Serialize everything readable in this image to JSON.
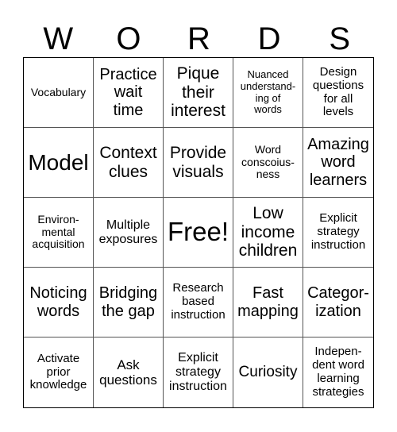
{
  "title_letters": [
    "W",
    "O",
    "R",
    "D",
    "S"
  ],
  "cells": [
    {
      "text": "Vocabulary",
      "size": 14
    },
    {
      "text": "Practice\nwait\ntime",
      "size": 20
    },
    {
      "text": "Pique\ntheir\ninterest",
      "size": 21
    },
    {
      "text": "Nuanced\nunderstand-\ning of\nwords",
      "size": 13
    },
    {
      "text": "Design\nquestions\nfor all\nlevels",
      "size": 15
    },
    {
      "text": "Model",
      "size": 28
    },
    {
      "text": "Context\nclues",
      "size": 21
    },
    {
      "text": "Provide\nvisuals",
      "size": 21
    },
    {
      "text": "Word\nconscoius-\nness",
      "size": 14
    },
    {
      "text": "Amazing\nword\nlearners",
      "size": 20
    },
    {
      "text": "Environ-\nmental\nacquisition",
      "size": 14
    },
    {
      "text": "Multiple\nexposures",
      "size": 16
    },
    {
      "text": "Free!",
      "size": 33
    },
    {
      "text": "Low\nincome\nchildren",
      "size": 21
    },
    {
      "text": "Explicit\nstrategy\ninstruction",
      "size": 15
    },
    {
      "text": "Noticing\nwords",
      "size": 20
    },
    {
      "text": "Bridging\nthe gap",
      "size": 20
    },
    {
      "text": "Research\nbased\ninstruction",
      "size": 15
    },
    {
      "text": "Fast\nmapping",
      "size": 20
    },
    {
      "text": "Categor-\nization",
      "size": 20
    },
    {
      "text": "Activate\nprior\nknowledge",
      "size": 15
    },
    {
      "text": "Ask\nquestions",
      "size": 17
    },
    {
      "text": "Explicit\nstrategy\ninstruction",
      "size": 16
    },
    {
      "text": "Curiosity",
      "size": 19
    },
    {
      "text": "Indepen-\ndent word\nlearning\nstrategies",
      "size": 15
    }
  ]
}
